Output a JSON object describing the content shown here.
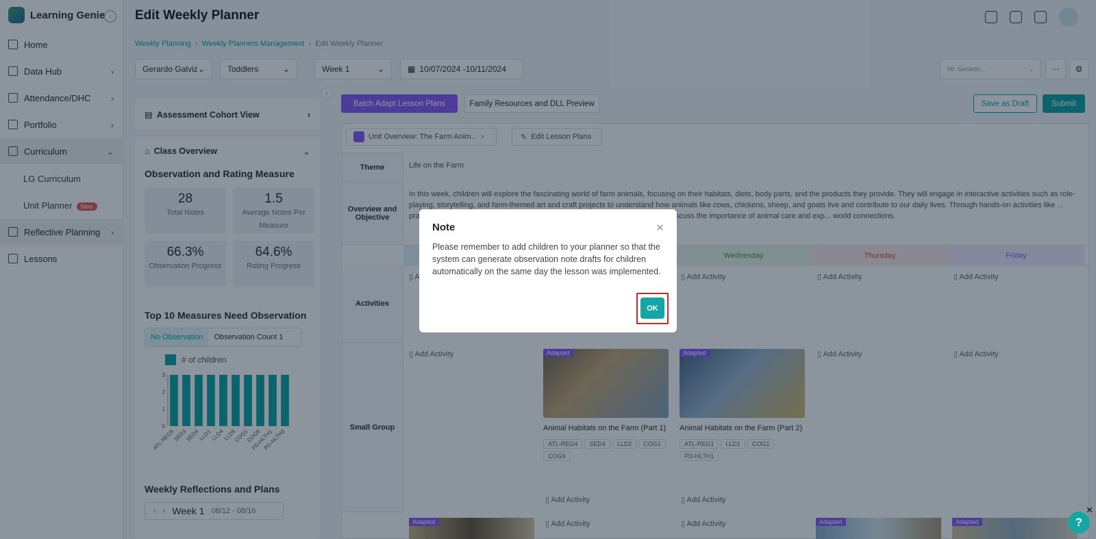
{
  "app": {
    "name": "Learning Genie"
  },
  "header": {
    "title": "Edit Weekly Planner"
  },
  "breadcrumb": [
    "Weekly Planning",
    "Weekly Planners Management",
    "Edit Weekly Planner"
  ],
  "sidebar": {
    "items": [
      {
        "label": "Home",
        "icon": "home-icon"
      },
      {
        "label": "Data Hub",
        "icon": "bar-chart-icon"
      },
      {
        "label": "Attendance/DHC",
        "icon": "calendar-icon"
      },
      {
        "label": "Portfolio",
        "icon": "portfolio-icon"
      },
      {
        "label": "Curriculum",
        "icon": "book-icon"
      },
      {
        "label": "LG Curriculum"
      },
      {
        "label": "Unit Planner",
        "badge": "New"
      },
      {
        "label": "Reflective Planning",
        "icon": "reflect-icon"
      },
      {
        "label": "Lessons",
        "icon": "lessons-icon"
      }
    ]
  },
  "filters": {
    "teacher": "Gerardo Galviz",
    "group": "Toddlers",
    "week": "Week 1",
    "date_range": "10/07/2024 -10/11/2024",
    "assignee": "Mr. Gerardo..."
  },
  "toolbar": {
    "batch_adapt": "Batch Adapt Lesson Plans",
    "family_resources": "Family Resources and DLL Preview",
    "save_draft": "Save as Draft",
    "submit": "Submit",
    "unit_overview": "Unit Overview: The Farm Anim...",
    "edit_lessons": "Edit Lesson Plans"
  },
  "leftpanel": {
    "assessment": "Assessment Cohort View",
    "class_overview": "Class Overview",
    "obs_heading": "Observation and Rating Measure",
    "stats": [
      {
        "value": "28",
        "label": "Total Notes"
      },
      {
        "value": "1.5",
        "label": "Average Notes Per Measure"
      },
      {
        "value": "66.3%",
        "label": "Observation Progress"
      },
      {
        "value": "64.6%",
        "label": "Rating Progress"
      }
    ],
    "top10_heading": "Top 10 Measures Need Observation",
    "tabs": [
      "No Observation",
      "Observation Count 1"
    ],
    "legend": "# of children",
    "reflections_heading": "Weekly Reflections and Plans",
    "week_label": "Week 1",
    "week_dates": "08/12 - 08/16"
  },
  "chart_data": {
    "type": "bar",
    "categories": [
      "ATL-REG5",
      "SED3",
      "SED4",
      "LLD1",
      "LLD4",
      "LLD5",
      "COG1",
      "COG8",
      "PD-HLTH1",
      "PD-HLTH3"
    ],
    "values": [
      3,
      3,
      3,
      3,
      3,
      3,
      3,
      3,
      3,
      3
    ],
    "series": [
      {
        "name": "# of children",
        "values": [
          3,
          3,
          3,
          3,
          3,
          3,
          3,
          3,
          3,
          3
        ]
      }
    ],
    "ylim": [
      0,
      3
    ],
    "yticks": [
      0,
      1,
      2,
      3
    ],
    "color": "#14a6a4"
  },
  "plan": {
    "theme_label": "Theme",
    "theme_value": "Life on the Farm",
    "overview_label": "Overview and Objective",
    "overview_text": "In this week, children will explore the fascinating world of farm animals, focusing on their habitats, diets, body parts, and the products they provide. They will engage in interactive activities such as role-playing, storytelling, and farm-themed art and craft projects to understand how animals like cows, chickens, sheep, and goats live and contribute to our daily lives. Through hands-on activities like ... practice observation, critical thinking, and communication skills. They will also discuss the importance of animal care and exp... world connections.",
    "days": [
      "Wednesday",
      "Thursday",
      "Friday"
    ],
    "activities_label": "Activities",
    "small_group_label": "Small Group",
    "add_activity": "Add Activity",
    "adapted": "Adapted",
    "lessons": [
      {
        "title": "Animal Habitats on the Farm (Part 1)",
        "tags": [
          "ATL-REG4",
          "SED4",
          "LLD2",
          "COG1",
          "COG9"
        ]
      },
      {
        "title": "Animal Habitats on the Farm (Part 2)",
        "tags": [
          "ATL-REG1",
          "LLD1",
          "COG1",
          "PD-HLTH1"
        ]
      }
    ]
  },
  "modal": {
    "title": "Note",
    "body": "Please remember to add children to your planner so that the system can generate observation note drafts for children automatically on the same day the lesson was implemented.",
    "ok": "OK"
  },
  "help": "?"
}
